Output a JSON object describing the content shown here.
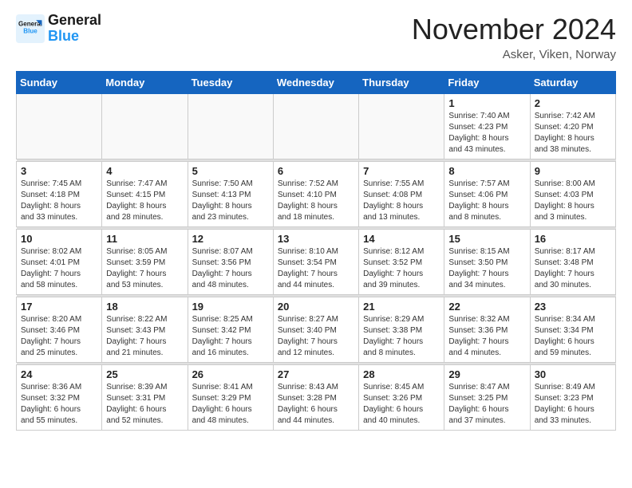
{
  "header": {
    "logo_line1": "General",
    "logo_line2": "Blue",
    "month_title": "November 2024",
    "location": "Asker, Viken, Norway"
  },
  "weekdays": [
    "Sunday",
    "Monday",
    "Tuesday",
    "Wednesday",
    "Thursday",
    "Friday",
    "Saturday"
  ],
  "weeks": [
    [
      {
        "day": "",
        "info": ""
      },
      {
        "day": "",
        "info": ""
      },
      {
        "day": "",
        "info": ""
      },
      {
        "day": "",
        "info": ""
      },
      {
        "day": "",
        "info": ""
      },
      {
        "day": "1",
        "info": "Sunrise: 7:40 AM\nSunset: 4:23 PM\nDaylight: 8 hours\nand 43 minutes."
      },
      {
        "day": "2",
        "info": "Sunrise: 7:42 AM\nSunset: 4:20 PM\nDaylight: 8 hours\nand 38 minutes."
      }
    ],
    [
      {
        "day": "3",
        "info": "Sunrise: 7:45 AM\nSunset: 4:18 PM\nDaylight: 8 hours\nand 33 minutes."
      },
      {
        "day": "4",
        "info": "Sunrise: 7:47 AM\nSunset: 4:15 PM\nDaylight: 8 hours\nand 28 minutes."
      },
      {
        "day": "5",
        "info": "Sunrise: 7:50 AM\nSunset: 4:13 PM\nDaylight: 8 hours\nand 23 minutes."
      },
      {
        "day": "6",
        "info": "Sunrise: 7:52 AM\nSunset: 4:10 PM\nDaylight: 8 hours\nand 18 minutes."
      },
      {
        "day": "7",
        "info": "Sunrise: 7:55 AM\nSunset: 4:08 PM\nDaylight: 8 hours\nand 13 minutes."
      },
      {
        "day": "8",
        "info": "Sunrise: 7:57 AM\nSunset: 4:06 PM\nDaylight: 8 hours\nand 8 minutes."
      },
      {
        "day": "9",
        "info": "Sunrise: 8:00 AM\nSunset: 4:03 PM\nDaylight: 8 hours\nand 3 minutes."
      }
    ],
    [
      {
        "day": "10",
        "info": "Sunrise: 8:02 AM\nSunset: 4:01 PM\nDaylight: 7 hours\nand 58 minutes."
      },
      {
        "day": "11",
        "info": "Sunrise: 8:05 AM\nSunset: 3:59 PM\nDaylight: 7 hours\nand 53 minutes."
      },
      {
        "day": "12",
        "info": "Sunrise: 8:07 AM\nSunset: 3:56 PM\nDaylight: 7 hours\nand 48 minutes."
      },
      {
        "day": "13",
        "info": "Sunrise: 8:10 AM\nSunset: 3:54 PM\nDaylight: 7 hours\nand 44 minutes."
      },
      {
        "day": "14",
        "info": "Sunrise: 8:12 AM\nSunset: 3:52 PM\nDaylight: 7 hours\nand 39 minutes."
      },
      {
        "day": "15",
        "info": "Sunrise: 8:15 AM\nSunset: 3:50 PM\nDaylight: 7 hours\nand 34 minutes."
      },
      {
        "day": "16",
        "info": "Sunrise: 8:17 AM\nSunset: 3:48 PM\nDaylight: 7 hours\nand 30 minutes."
      }
    ],
    [
      {
        "day": "17",
        "info": "Sunrise: 8:20 AM\nSunset: 3:46 PM\nDaylight: 7 hours\nand 25 minutes."
      },
      {
        "day": "18",
        "info": "Sunrise: 8:22 AM\nSunset: 3:43 PM\nDaylight: 7 hours\nand 21 minutes."
      },
      {
        "day": "19",
        "info": "Sunrise: 8:25 AM\nSunset: 3:42 PM\nDaylight: 7 hours\nand 16 minutes."
      },
      {
        "day": "20",
        "info": "Sunrise: 8:27 AM\nSunset: 3:40 PM\nDaylight: 7 hours\nand 12 minutes."
      },
      {
        "day": "21",
        "info": "Sunrise: 8:29 AM\nSunset: 3:38 PM\nDaylight: 7 hours\nand 8 minutes."
      },
      {
        "day": "22",
        "info": "Sunrise: 8:32 AM\nSunset: 3:36 PM\nDaylight: 7 hours\nand 4 minutes."
      },
      {
        "day": "23",
        "info": "Sunrise: 8:34 AM\nSunset: 3:34 PM\nDaylight: 6 hours\nand 59 minutes."
      }
    ],
    [
      {
        "day": "24",
        "info": "Sunrise: 8:36 AM\nSunset: 3:32 PM\nDaylight: 6 hours\nand 55 minutes."
      },
      {
        "day": "25",
        "info": "Sunrise: 8:39 AM\nSunset: 3:31 PM\nDaylight: 6 hours\nand 52 minutes."
      },
      {
        "day": "26",
        "info": "Sunrise: 8:41 AM\nSunset: 3:29 PM\nDaylight: 6 hours\nand 48 minutes."
      },
      {
        "day": "27",
        "info": "Sunrise: 8:43 AM\nSunset: 3:28 PM\nDaylight: 6 hours\nand 44 minutes."
      },
      {
        "day": "28",
        "info": "Sunrise: 8:45 AM\nSunset: 3:26 PM\nDaylight: 6 hours\nand 40 minutes."
      },
      {
        "day": "29",
        "info": "Sunrise: 8:47 AM\nSunset: 3:25 PM\nDaylight: 6 hours\nand 37 minutes."
      },
      {
        "day": "30",
        "info": "Sunrise: 8:49 AM\nSunset: 3:23 PM\nDaylight: 6 hours\nand 33 minutes."
      }
    ]
  ]
}
